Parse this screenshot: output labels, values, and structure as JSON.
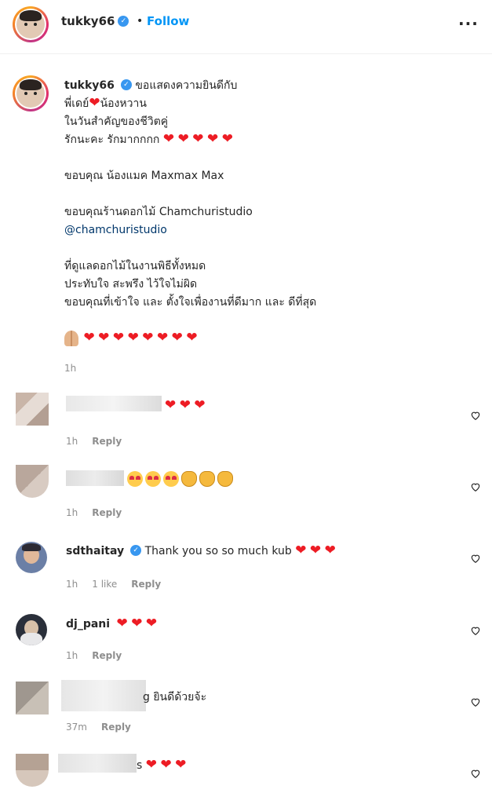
{
  "header": {
    "username": "tukky66",
    "separator": "•",
    "follow_label": "Follow",
    "more_label": "···"
  },
  "caption": {
    "username": "tukky66",
    "lines": [
      "ขอแสดงความยินดีกับ",
      "พี่เดย์",
      "น้องหวาน",
      "ในวันสำคัญของชีวิตคู่",
      "รักนะคะ รักมากกกก",
      "ขอบคุณ น้องแมค Maxmax Max",
      "ขอบคุณร้านดอกไม้ Chamchuristudio",
      "@chamchuristudio",
      "ที่ดูแลดอกไม้ในงานพิธีทั้งหมด",
      "ประทับใจ สะพรึง ไว้ใจไม่ผิด",
      "ขอบคุณที่เข้าใจ และ ตั้งใจเพื่องานที่ดีมาก และ ดีที่สุด"
    ],
    "heart": "❤",
    "time": "1h"
  },
  "comments": [
    {
      "username": "",
      "text": "",
      "time": "1h",
      "reply_label": "Reply"
    },
    {
      "username": "",
      "text": "",
      "time": "1h",
      "reply_label": "Reply"
    },
    {
      "username": "sdthaitay",
      "text": "Thank you so so much kub",
      "time": "1h",
      "likes": "1 like",
      "reply_label": "Reply"
    },
    {
      "username": "dj_pani",
      "text": "",
      "time": "1h",
      "reply_label": "Reply"
    },
    {
      "username": "",
      "text_tail": "g",
      "text": "ยินดีด้วยจ้ะ",
      "time": "37m",
      "reply_label": "Reply"
    },
    {
      "username": "",
      "text_tail": "s",
      "text": "",
      "time": "",
      "reply_label": ""
    }
  ],
  "colors": {
    "accent": "#0095f6",
    "verified": "#3897f0",
    "heart": "#ed1c24",
    "mention": "#00376b",
    "meta": "#8e8e8e"
  },
  "icons": [
    "verified-badge-icon",
    "more-options-icon",
    "heart-emoji",
    "heart-outline-icon",
    "heart-eyes-emoji",
    "clapping-hands-emoji",
    "folded-hands-emoji"
  ]
}
